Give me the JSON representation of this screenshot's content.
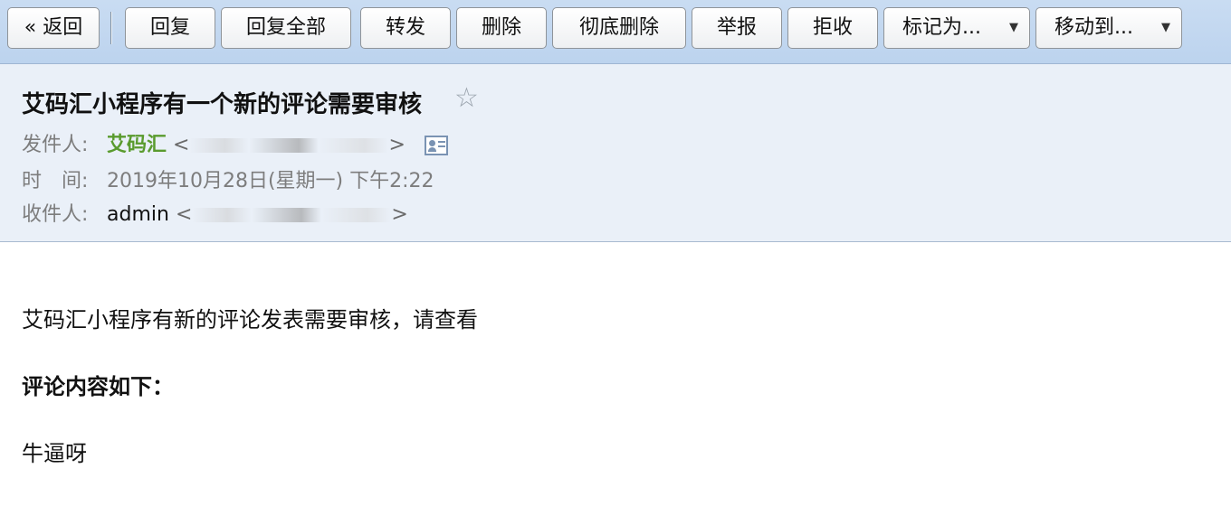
{
  "toolbar": {
    "back_label": "« 返回",
    "reply_label": "回复",
    "reply_all_label": "回复全部",
    "forward_label": "转发",
    "delete_label": "删除",
    "delete_permanently_label": "彻底删除",
    "report_label": "举报",
    "reject_label": "拒收",
    "mark_as_label": "标记为...",
    "move_to_label": "移动到..."
  },
  "header": {
    "subject": "艾码汇小程序有一个新的评论需要审核",
    "star_icon": "☆",
    "sender_label": "发件人:",
    "sender_name": "艾码汇",
    "sender_addr_open": "<",
    "sender_addr_close": ">",
    "time_label": "时　间:",
    "time_value": "2019年10月28日(星期一) 下午2:22",
    "recipient_label": "收件人:",
    "recipient_name": "admin",
    "recipient_addr_open": "<",
    "recipient_addr_close": ">"
  },
  "body": {
    "line1": "艾码汇小程序有新的评论发表需要审核，请查看",
    "line2": "评论内容如下：",
    "line3": "牛逼呀"
  },
  "colors": {
    "toolbar_bg": "#c9dcf2",
    "header_bg": "#eaf0f8",
    "sender_name": "#5a9b2e"
  }
}
